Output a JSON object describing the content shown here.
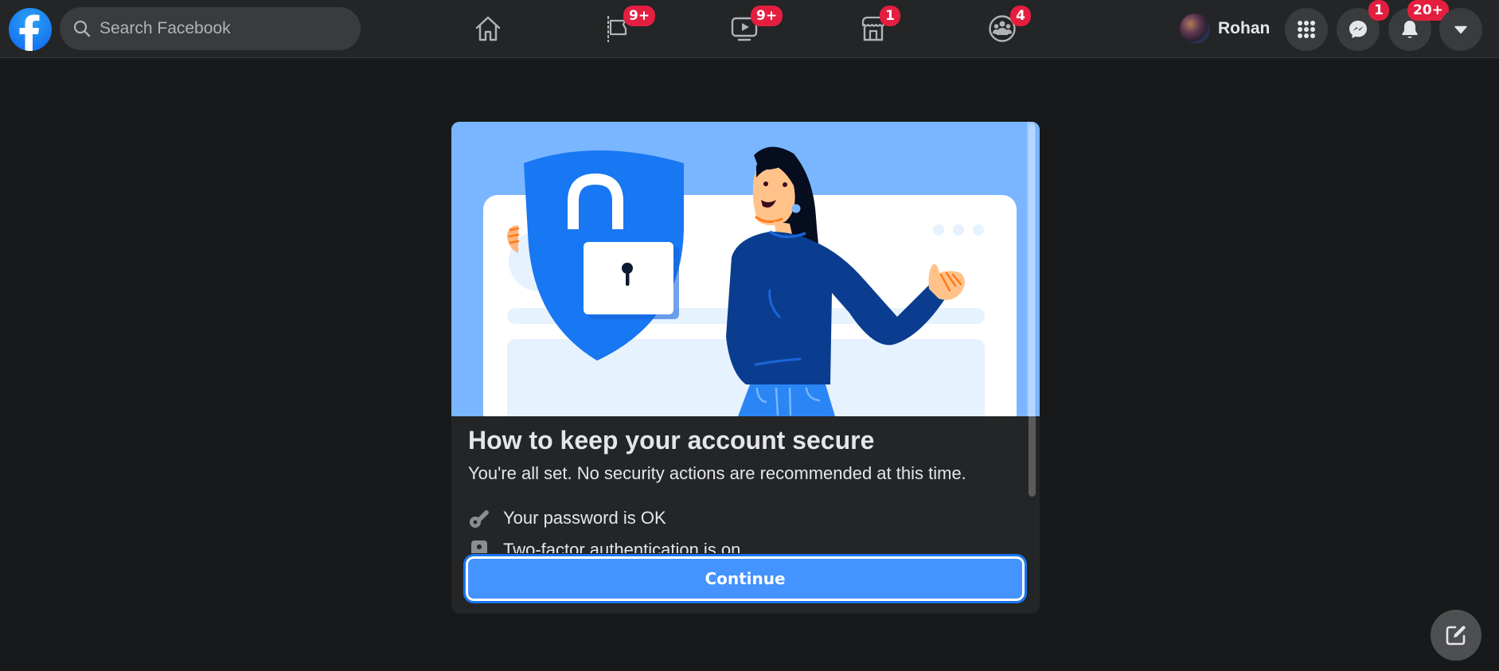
{
  "nav": {
    "logo": "facebook-logo",
    "search_placeholder": "Search Facebook",
    "search_value": "",
    "center_tabs": [
      {
        "name": "home",
        "icon": "home-icon",
        "badge": ""
      },
      {
        "name": "pages",
        "icon": "flag-icon",
        "badge": "9+"
      },
      {
        "name": "watch",
        "icon": "video-icon",
        "badge": "9+"
      },
      {
        "name": "marketplace",
        "icon": "marketplace-icon",
        "badge": "1"
      },
      {
        "name": "groups",
        "icon": "groups-icon",
        "badge": "4"
      }
    ],
    "profile_name": "Rohan",
    "right_buttons": [
      {
        "name": "menu",
        "icon": "grid-menu-icon",
        "badge": ""
      },
      {
        "name": "messenger",
        "icon": "messenger-icon",
        "badge": "1"
      },
      {
        "name": "notifications",
        "icon": "bell-icon",
        "badge": "20+"
      },
      {
        "name": "account",
        "icon": "caret-down-icon",
        "badge": ""
      }
    ]
  },
  "modal": {
    "title": "How to keep your account secure",
    "description": "You're all set. No security actions are recommended at this time.",
    "items": [
      {
        "icon": "key-icon",
        "label": "Your password is OK"
      },
      {
        "icon": "lock-shield-icon",
        "label": "Two-factor authentication is on"
      }
    ],
    "continue_label": "Continue"
  },
  "colors": {
    "accent": "#1877f2",
    "badge": "#e41e3f",
    "button": "#4493ff",
    "background": "#18191a",
    "surface": "#242526"
  }
}
